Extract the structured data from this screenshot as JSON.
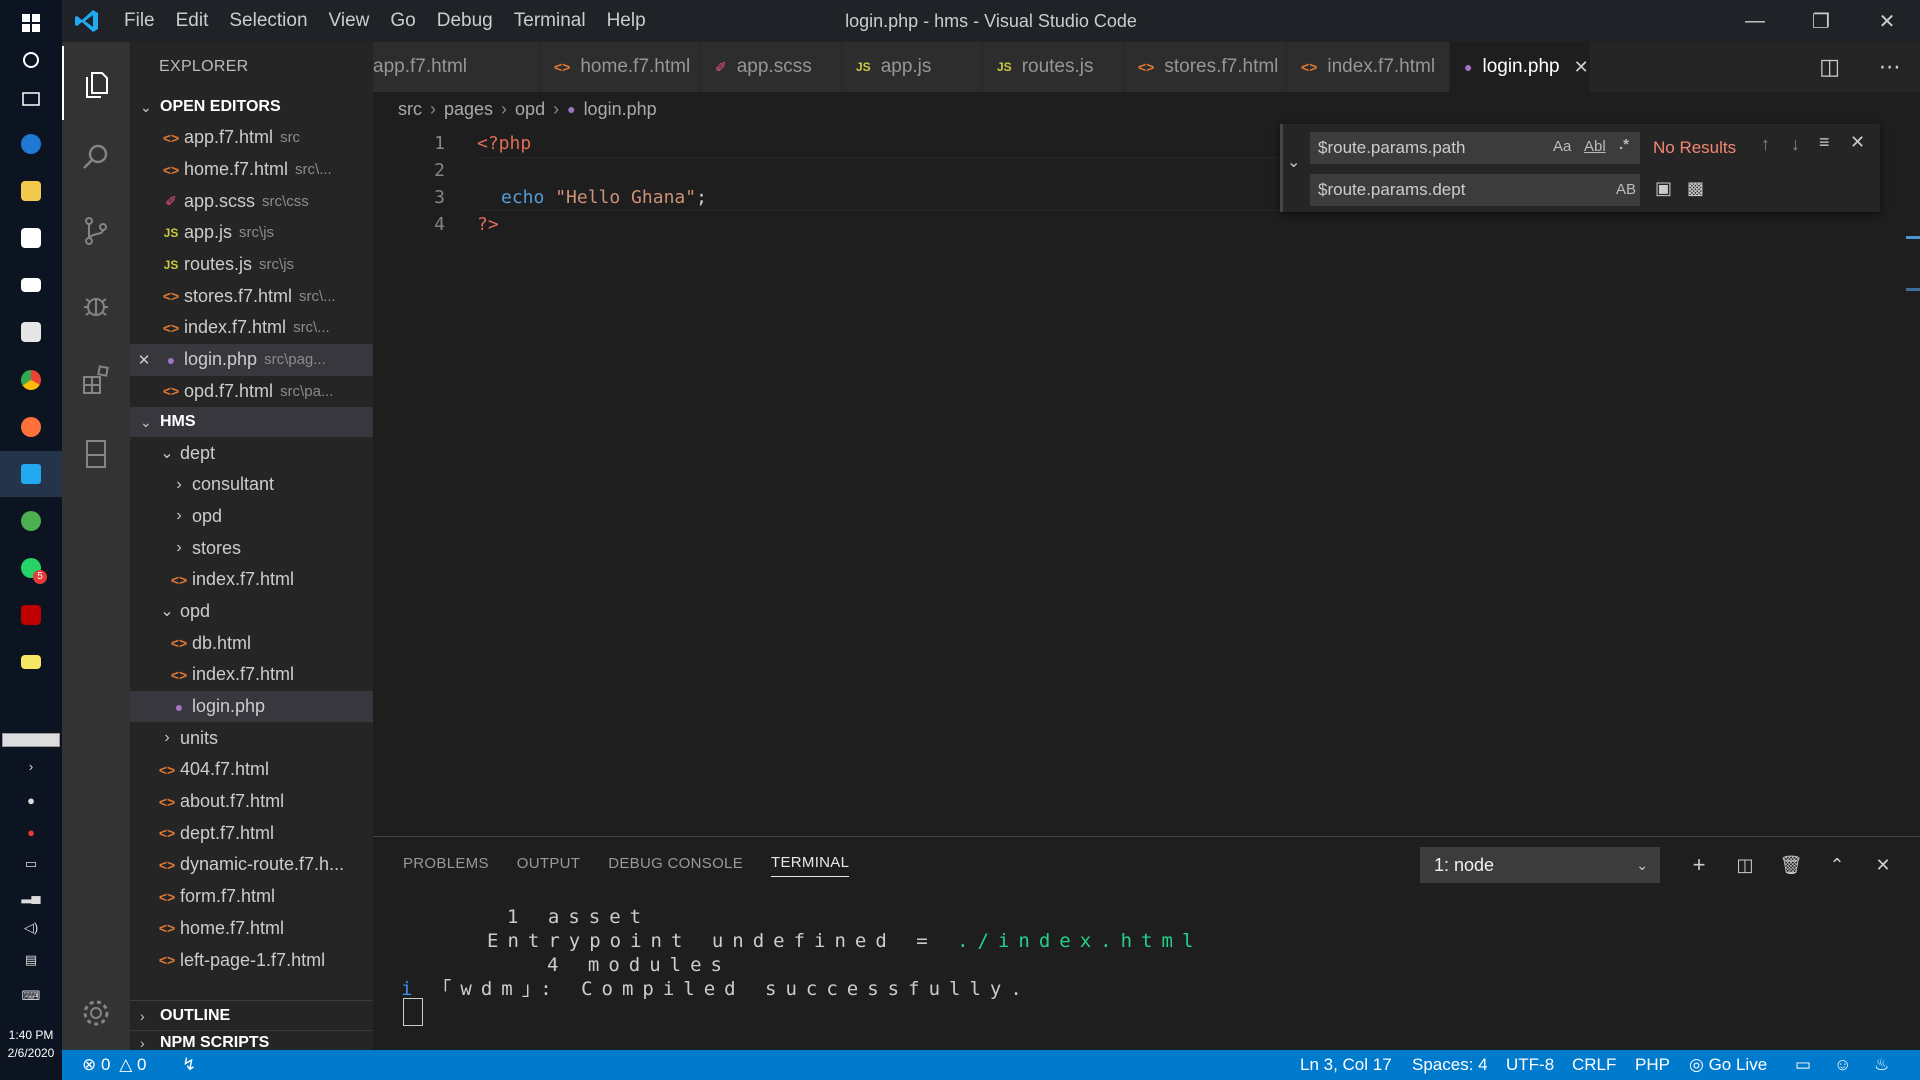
{
  "window": {
    "title": "login.php - hms - Visual Studio Code",
    "menu": [
      "File",
      "Edit",
      "Selection",
      "View",
      "Go",
      "Debug",
      "Terminal",
      "Help"
    ]
  },
  "taskbar": {
    "clock_time": "1:40 PM",
    "clock_date": "2/6/2020",
    "badge": "5"
  },
  "sidebar": {
    "title": "EXPLORER",
    "open_editors_label": "OPEN EDITORS",
    "open_editors": [
      {
        "name": "app.f7.html",
        "desc": "src",
        "type": "html"
      },
      {
        "name": "home.f7.html",
        "desc": "src\\...",
        "type": "html"
      },
      {
        "name": "app.scss",
        "desc": "src\\css",
        "type": "scss"
      },
      {
        "name": "app.js",
        "desc": "src\\js",
        "type": "js"
      },
      {
        "name": "routes.js",
        "desc": "src\\js",
        "type": "js"
      },
      {
        "name": "stores.f7.html",
        "desc": "src\\...",
        "type": "html"
      },
      {
        "name": "index.f7.html",
        "desc": "src\\...",
        "type": "html"
      },
      {
        "name": "login.php",
        "desc": "src\\pag...",
        "type": "php",
        "active": true
      },
      {
        "name": "opd.f7.html",
        "desc": "src\\pa...",
        "type": "html"
      }
    ],
    "project_label": "HMS",
    "tree": [
      {
        "name": "dept",
        "kind": "folder-open"
      },
      {
        "name": "consultant",
        "kind": "folder"
      },
      {
        "name": "opd",
        "kind": "folder"
      },
      {
        "name": "stores",
        "kind": "folder"
      },
      {
        "name": "index.f7.html",
        "kind": "html"
      },
      {
        "name": "opd",
        "kind": "folder-open"
      },
      {
        "name": "db.html",
        "kind": "html"
      },
      {
        "name": "index.f7.html",
        "kind": "html"
      },
      {
        "name": "login.php",
        "kind": "php"
      },
      {
        "name": "units",
        "kind": "folder"
      },
      {
        "name": "404.f7.html",
        "kind": "html"
      },
      {
        "name": "about.f7.html",
        "kind": "html"
      },
      {
        "name": "dept.f7.html",
        "kind": "html"
      },
      {
        "name": "dynamic-route.f7.h...",
        "kind": "html"
      },
      {
        "name": "form.f7.html",
        "kind": "html"
      },
      {
        "name": "home.f7.html",
        "kind": "html"
      },
      {
        "name": "left-page-1.f7.html",
        "kind": "html"
      }
    ],
    "outline_label": "OUTLINE",
    "npm_label": "NPM SCRIPTS"
  },
  "tabs": [
    {
      "label": "app.f7.html",
      "type": "html"
    },
    {
      "label": "home.f7.html",
      "type": "html"
    },
    {
      "label": "app.scss",
      "type": "scss"
    },
    {
      "label": "app.js",
      "type": "js"
    },
    {
      "label": "routes.js",
      "type": "js"
    },
    {
      "label": "stores.f7.html",
      "type": "html"
    },
    {
      "label": "index.f7.html",
      "type": "html"
    },
    {
      "label": "login.php",
      "type": "php",
      "active": true
    }
  ],
  "breadcrumb": [
    "src",
    "pages",
    "opd",
    "login.php"
  ],
  "editor": {
    "lines": [
      {
        "num": "1",
        "open": "<?php"
      },
      {
        "num": "2"
      },
      {
        "num": "3",
        "echo": "echo",
        "str": "\"Hello Ghana\"",
        "punc": ";"
      },
      {
        "num": "4",
        "close": "?>"
      }
    ]
  },
  "find": {
    "search_value": "$route.params.path",
    "replace_value": "$route.params.dept",
    "result": "No Results",
    "opt_case": "Aa",
    "opt_word": "Abl",
    "opt_regex": ".*",
    "opt_preserve": "AB"
  },
  "panel": {
    "tabs": [
      "PROBLEMS",
      "OUTPUT",
      "DEBUG CONSOLE",
      "TERMINAL"
    ],
    "terminal_select": "1: node",
    "terminal_lines": {
      "l1": "1 asset",
      "l2_a": "Entrypoint undefined = ",
      "l2_b": "./index.html",
      "l3": "4 modules",
      "l4_i": "i",
      "l4_a": "｢wdm｣: Compiled successfully."
    }
  },
  "status": {
    "errors": "0",
    "warnings": "0",
    "position": "Ln 3, Col 17",
    "spaces": "Spaces: 4",
    "encoding": "UTF-8",
    "eol": "CRLF",
    "language": "PHP",
    "golive": "Go Live"
  },
  "colors": {
    "accent": "#007acc",
    "html_icon": "#e37933",
    "php_icon": "#a074c4",
    "js_icon": "#cbcb41",
    "scss_icon": "#f55385"
  }
}
